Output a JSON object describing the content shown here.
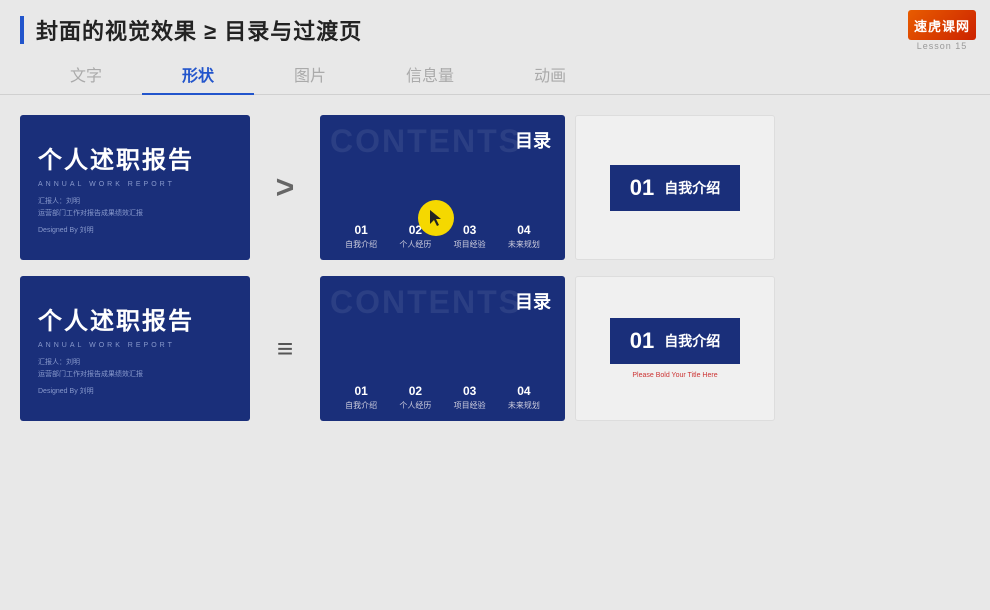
{
  "header": {
    "title": "封面的视觉效果 ≥ 目录与过渡页",
    "logo_text": "速虎课网",
    "lesson": "Lesson 15"
  },
  "tabs": [
    {
      "id": "text",
      "label": "文字",
      "active": false
    },
    {
      "id": "shape",
      "label": "形状",
      "active": true
    },
    {
      "id": "image",
      "label": "图片",
      "active": false
    },
    {
      "id": "info",
      "label": "信息量",
      "active": false
    },
    {
      "id": "animation",
      "label": "动画",
      "active": false
    }
  ],
  "row1": {
    "symbol": ">",
    "slide1": {
      "main_title": "个人述职报告",
      "sub_title": "ANNUAL WORK REPORT",
      "author_label": "汇报人：刘明",
      "dept_label": "运营部门工作对报告成果绩效汇报",
      "designer": "Designed By 刘明"
    },
    "slide2": {
      "bg_text": "CONTENTS",
      "title": "目录",
      "items": [
        {
          "num": "01",
          "label": "自我介绍"
        },
        {
          "num": "02",
          "label": "个人经历"
        },
        {
          "num": "03",
          "label": "项目经验"
        },
        {
          "num": "04",
          "label": "未来规划"
        }
      ]
    },
    "slide3": {
      "num": "01",
      "title": "自我介绍"
    }
  },
  "row2": {
    "symbol": "≡",
    "slide1": {
      "main_title": "个人述职报告",
      "sub_title": "ANNUAL WORK REPORT",
      "author_label": "汇报人：刘明",
      "dept_label": "运营部门工作对报告成果绩效汇报",
      "designer": "Designed By 刘明"
    },
    "slide2": {
      "bg_text": "CONTENTS",
      "title": "目录",
      "items": [
        {
          "num": "01",
          "label": "自我介绍"
        },
        {
          "num": "02",
          "label": "个人经历"
        },
        {
          "num": "03",
          "label": "项目经验"
        },
        {
          "num": "04",
          "label": "未来规划"
        }
      ]
    },
    "slide3": {
      "num": "01",
      "title": "自我介绍",
      "sub": "Please Bold Your Title Here"
    }
  }
}
